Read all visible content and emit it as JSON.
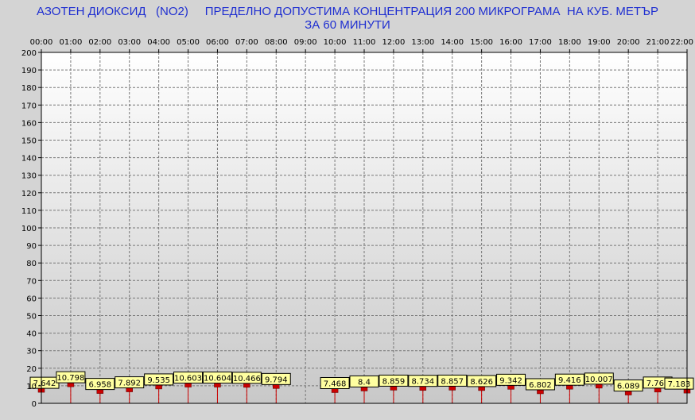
{
  "chart_data": {
    "type": "bar",
    "title_line1": "АЗОТЕН ДИОКСИД   (NO2)     ПРЕДЕЛНО ДОПУСТИМА КОНЦЕНТРАЦИЯ 200 МИКРОГРАМА  НА КУБ. МЕТЪР",
    "title_line2": "ЗА 60 МИНУТИ",
    "categories": [
      "00:00",
      "01:00",
      "02:00",
      "03:00",
      "04:00",
      "05:00",
      "06:00",
      "07:00",
      "08:00",
      "09:00",
      "10:00",
      "11:00",
      "12:00",
      "13:00",
      "14:00",
      "15:00",
      "16:00",
      "17:00",
      "18:00",
      "19:00",
      "20:00",
      "21:00",
      "22:00"
    ],
    "values": [
      7.642,
      10.798,
      6.958,
      7.892,
      9.535,
      10.603,
      10.604,
      10.466,
      9.794,
      null,
      7.468,
      8.4,
      8.859,
      8.734,
      8.857,
      8.626,
      9.342,
      6.802,
      9.416,
      10.007,
      6.089,
      7.763,
      7.183
    ],
    "labels": [
      "7.642",
      "10.798",
      "6.958",
      "7.892",
      "9.535",
      "10.603",
      "10.604",
      "10.466",
      "9.794",
      "",
      "7.468",
      "8.4",
      "8.859",
      "8.734",
      "8.857",
      "8.626",
      "9.342",
      "6.802",
      "9.416",
      "10.007",
      "6.089",
      "7.763",
      "7.183"
    ],
    "yticks": [
      "0",
      "10",
      "20",
      "30",
      "40",
      "50",
      "60",
      "70",
      "80",
      "90",
      "100",
      "110",
      "120",
      "130",
      "140",
      "150",
      "160",
      "170",
      "180",
      "190",
      "200"
    ],
    "ylim": [
      0,
      200
    ],
    "grid": true,
    "colors": {
      "bar": "#cc0000",
      "label_bg": "#ffffa0",
      "title": "#1f2fd1",
      "plot_top": "#ffffff",
      "plot_bottom": "#c8c8c8"
    }
  }
}
